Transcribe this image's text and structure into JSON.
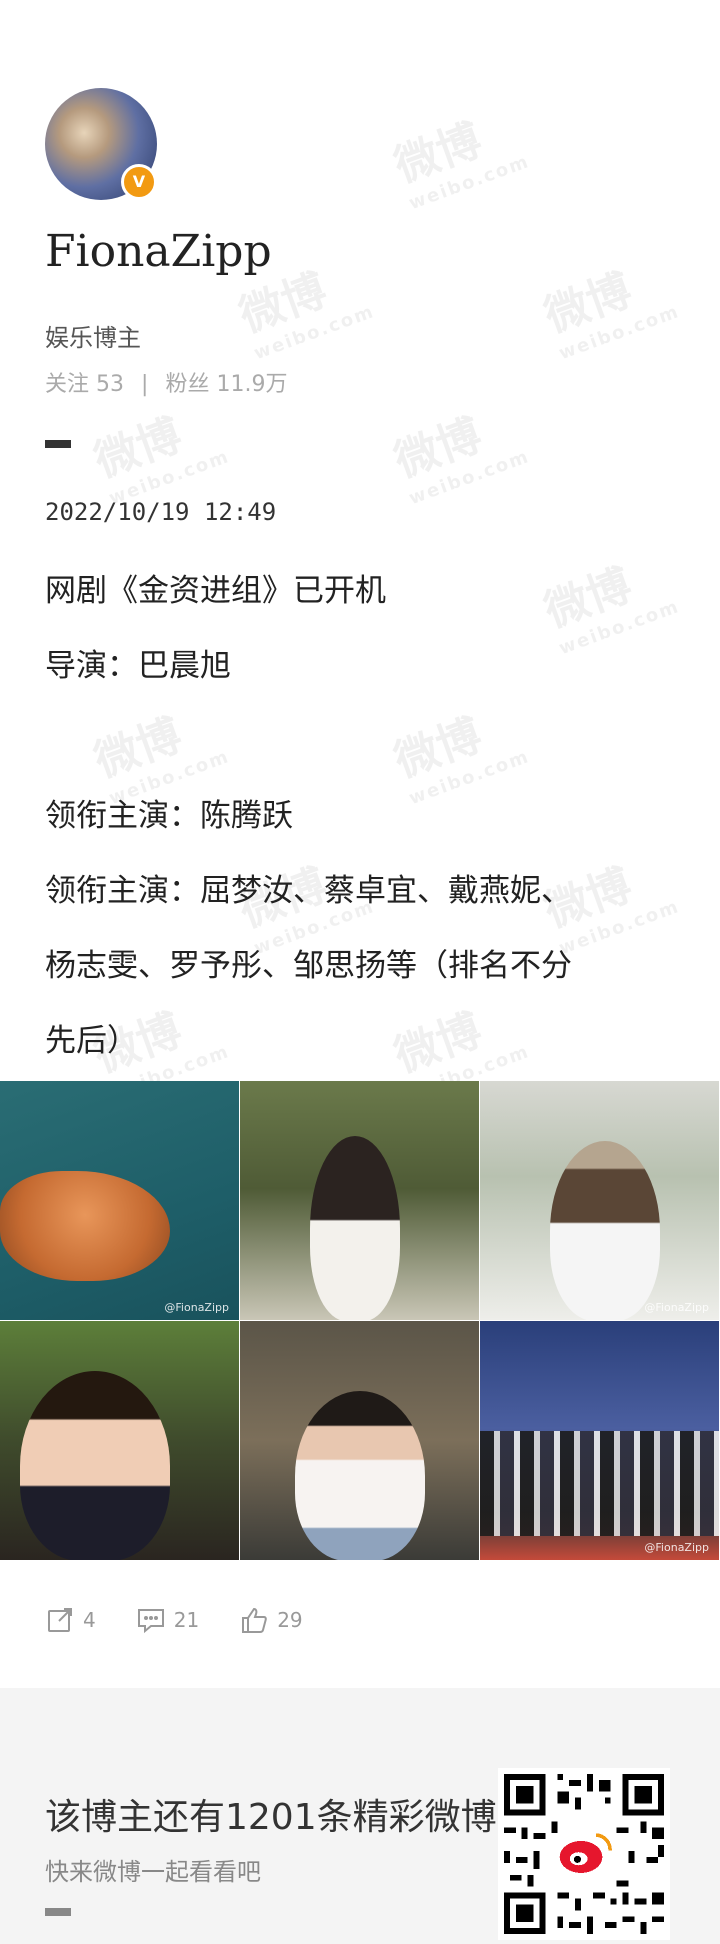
{
  "profile": {
    "username": "FionaZipp",
    "user_type": "娱乐博主",
    "following_label": "关注",
    "following_count": "53",
    "followers_label": "粉丝",
    "followers_count": "11.9万",
    "verified_badge": "V"
  },
  "post": {
    "timestamp": "2022/10/19 12:49",
    "lines": [
      "网剧《金资进组》已开机",
      "导演：巴晨旭",
      "领衔主演：陈腾跃",
      "领衔主演：屈梦汝、蔡卓宜、戴燕妮、",
      "杨志雯、罗予彤、邹思扬等（排名不分",
      "先后）"
    ],
    "images": [
      {
        "icon": "poster-gold-coins",
        "watermark": "@FionaZipp"
      },
      {
        "icon": "actress-white-dress-flowers",
        "watermark": ""
      },
      {
        "icon": "actress-cap-outdoor",
        "watermark": "@FionaZipp"
      },
      {
        "icon": "actress-drink-cup",
        "watermark": ""
      },
      {
        "icon": "actress-hands-on-head",
        "watermark": ""
      },
      {
        "icon": "cast-group-photo",
        "watermark": "@FionaZipp"
      }
    ]
  },
  "actions": {
    "repost_count": "4",
    "comment_count": "21",
    "like_count": "29"
  },
  "footer": {
    "title": "该博主还有1201条精彩微博",
    "subtitle": "快来微博一起看看吧"
  },
  "colors": {
    "badge": "#f29a12",
    "text_primary": "#222222",
    "text_secondary": "#999999",
    "footer_bg": "#f4f4f4"
  }
}
